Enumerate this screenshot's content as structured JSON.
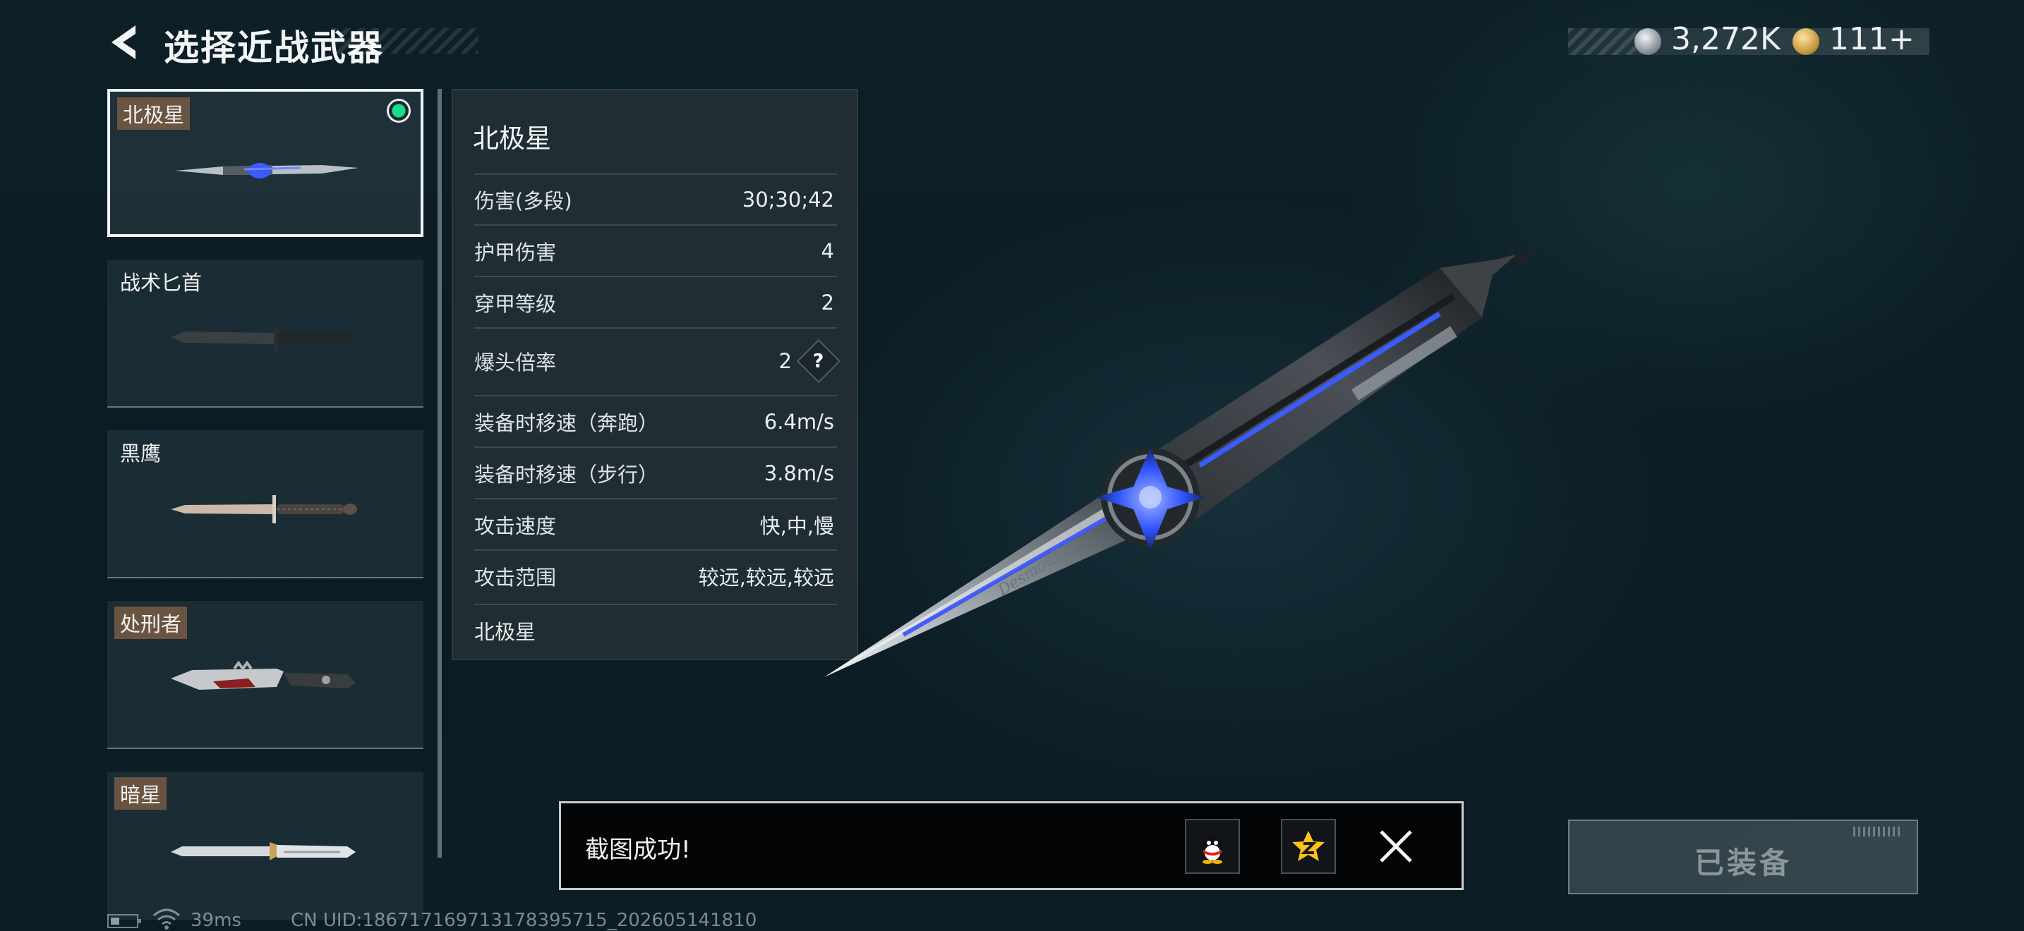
{
  "header": {
    "title": "选择近战武器",
    "currency": [
      {
        "icon": "silver-coin-icon",
        "value": "3,272K"
      },
      {
        "icon": "gold-coin-icon",
        "value": "111+"
      }
    ]
  },
  "weapons": [
    {
      "name": "北极星",
      "selected": true,
      "equipped": true,
      "tag": true
    },
    {
      "name": "战术匕首",
      "selected": false,
      "equipped": false,
      "tag": false
    },
    {
      "name": "黑鹰",
      "selected": false,
      "equipped": false,
      "tag": false
    },
    {
      "name": "处刑者",
      "selected": false,
      "equipped": false,
      "tag": true
    },
    {
      "name": "暗星",
      "selected": false,
      "equipped": false,
      "tag": true
    }
  ],
  "stats": {
    "title": "北极星",
    "rows": [
      {
        "label": "伤害(多段)",
        "value": "30;30;42"
      },
      {
        "label": "护甲伤害",
        "value": "4"
      },
      {
        "label": "穿甲等级",
        "value": "2"
      },
      {
        "label": "爆头倍率",
        "value": "2",
        "help": "?"
      },
      {
        "label": "装备时移速（奔跑）",
        "value": "6.4m/s"
      },
      {
        "label": "装备时移速（步行）",
        "value": "3.8m/s"
      },
      {
        "label": "攻击速度",
        "value": "快,中,慢"
      },
      {
        "label": "攻击范围",
        "value": "较远,较远,较远"
      }
    ],
    "description": "北极星"
  },
  "toast": {
    "message": "截图成功!",
    "buttons": [
      "qq-share-icon",
      "qzone-share-icon"
    ],
    "close_icon": "close-icon"
  },
  "equip_button": {
    "label": "已装备",
    "disabled": true
  },
  "footer": {
    "ping": "39ms",
    "uid": "CN UID:186717169713178395715_202605141810"
  },
  "colors": {
    "accent_green": "#18e08a",
    "knife_blue": "#3a5cff",
    "background": "#0c1d25"
  }
}
